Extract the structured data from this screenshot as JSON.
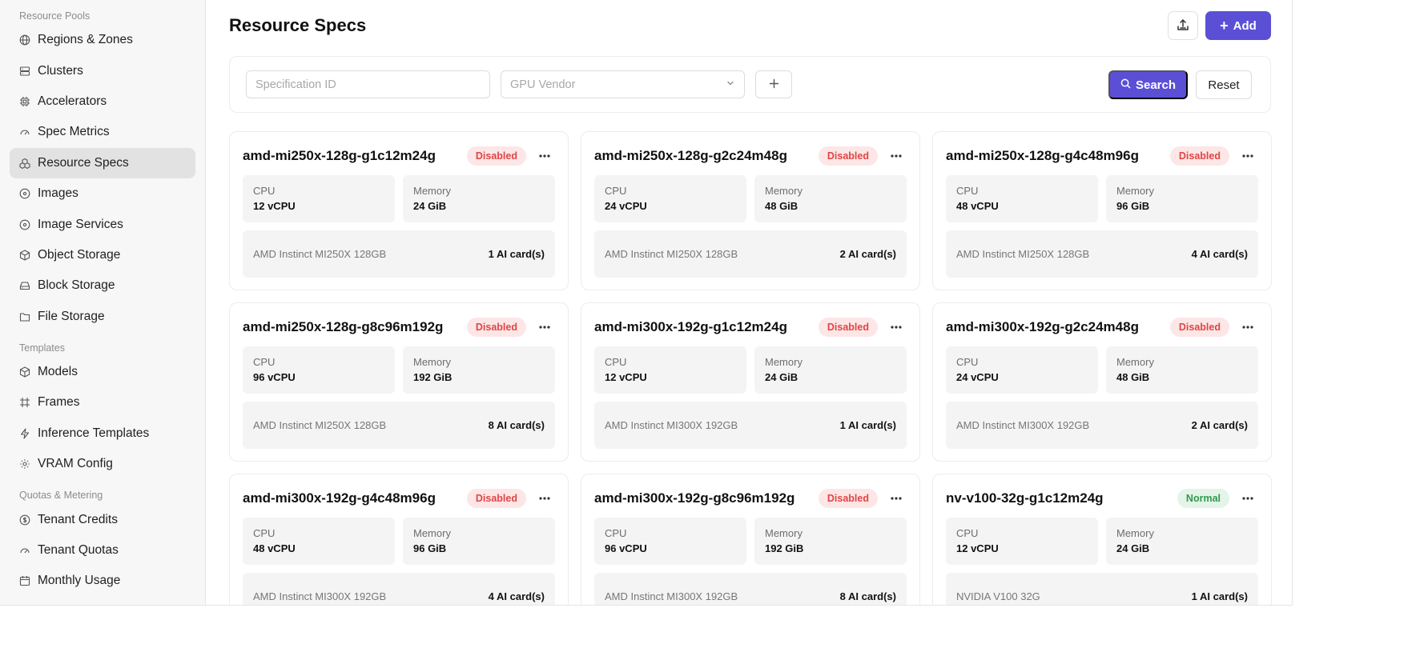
{
  "sidebar": {
    "sections": [
      {
        "title": "Resource Pools",
        "items": [
          {
            "label": "Regions & Zones",
            "icon": "globe-icon"
          },
          {
            "label": "Clusters",
            "icon": "server-icon"
          },
          {
            "label": "Accelerators",
            "icon": "cpu-icon"
          },
          {
            "label": "Spec Metrics",
            "icon": "gauge-icon"
          },
          {
            "label": "Resource Specs",
            "icon": "boxes-icon",
            "active": true
          },
          {
            "label": "Images",
            "icon": "disc-icon"
          },
          {
            "label": "Image Services",
            "icon": "disc-icon"
          },
          {
            "label": "Object Storage",
            "icon": "package-icon"
          },
          {
            "label": "Block Storage",
            "icon": "hard-drive-icon"
          },
          {
            "label": "File Storage",
            "icon": "folder-icon"
          }
        ]
      },
      {
        "title": "Templates",
        "items": [
          {
            "label": "Models",
            "icon": "package-icon"
          },
          {
            "label": "Frames",
            "icon": "frame-icon"
          },
          {
            "label": "Inference Templates",
            "icon": "zap-icon"
          },
          {
            "label": "VRAM Config",
            "icon": "gear-icon"
          }
        ]
      },
      {
        "title": "Quotas & Metering",
        "items": [
          {
            "label": "Tenant Credits",
            "icon": "coin-icon"
          },
          {
            "label": "Tenant Quotas",
            "icon": "gauge-icon"
          },
          {
            "label": "Monthly Usage",
            "icon": "calendar-icon"
          }
        ]
      }
    ]
  },
  "header": {
    "title": "Resource Specs",
    "export_icon": "export-icon",
    "add_label": "Add"
  },
  "filters": {
    "spec_id_placeholder": "Specification ID",
    "vendor_placeholder": "GPU Vendor",
    "search_label": "Search",
    "reset_label": "Reset"
  },
  "cards": [
    {
      "name": "amd-mi250x-128g-g1c12m24g",
      "status": "Disabled",
      "cpu_label": "CPU",
      "cpu": "12 vCPU",
      "mem_label": "Memory",
      "memory": "24 GiB",
      "gpu": "AMD Instinct MI250X 128GB",
      "cards": "1 AI card(s)"
    },
    {
      "name": "amd-mi250x-128g-g2c24m48g",
      "status": "Disabled",
      "cpu_label": "CPU",
      "cpu": "24 vCPU",
      "mem_label": "Memory",
      "memory": "48 GiB",
      "gpu": "AMD Instinct MI250X 128GB",
      "cards": "2 AI card(s)"
    },
    {
      "name": "amd-mi250x-128g-g4c48m96g",
      "status": "Disabled",
      "cpu_label": "CPU",
      "cpu": "48 vCPU",
      "mem_label": "Memory",
      "memory": "96 GiB",
      "gpu": "AMD Instinct MI250X 128GB",
      "cards": "4 AI card(s)"
    },
    {
      "name": "amd-mi250x-128g-g8c96m192g",
      "status": "Disabled",
      "cpu_label": "CPU",
      "cpu": "96 vCPU",
      "mem_label": "Memory",
      "memory": "192 GiB",
      "gpu": "AMD Instinct MI250X 128GB",
      "cards": "8 AI card(s)"
    },
    {
      "name": "amd-mi300x-192g-g1c12m24g",
      "status": "Disabled",
      "cpu_label": "CPU",
      "cpu": "12 vCPU",
      "mem_label": "Memory",
      "memory": "24 GiB",
      "gpu": "AMD Instinct MI300X 192GB",
      "cards": "1 AI card(s)"
    },
    {
      "name": "amd-mi300x-192g-g2c24m48g",
      "status": "Disabled",
      "cpu_label": "CPU",
      "cpu": "24 vCPU",
      "mem_label": "Memory",
      "memory": "48 GiB",
      "gpu": "AMD Instinct MI300X 192GB",
      "cards": "2 AI card(s)"
    },
    {
      "name": "amd-mi300x-192g-g4c48m96g",
      "status": "Disabled",
      "cpu_label": "CPU",
      "cpu": "48 vCPU",
      "mem_label": "Memory",
      "memory": "96 GiB",
      "gpu": "AMD Instinct MI300X 192GB",
      "cards": "4 AI card(s)"
    },
    {
      "name": "amd-mi300x-192g-g8c96m192g",
      "status": "Disabled",
      "cpu_label": "CPU",
      "cpu": "96 vCPU",
      "mem_label": "Memory",
      "memory": "192 GiB",
      "gpu": "AMD Instinct MI300X 192GB",
      "cards": "8 AI card(s)"
    },
    {
      "name": "nv-v100-32g-g1c12m24g",
      "status": "Normal",
      "cpu_label": "CPU",
      "cpu": "12 vCPU",
      "mem_label": "Memory",
      "memory": "24 GiB",
      "gpu": "NVIDIA V100 32G",
      "cards": "1 AI card(s)"
    }
  ],
  "colors": {
    "accent": "#5b4fd6",
    "disabled_badge_bg": "#fde6e6",
    "disabled_badge_text": "#e04545",
    "normal_badge_bg": "#e4f4e8",
    "normal_badge_text": "#2f9a4e"
  }
}
